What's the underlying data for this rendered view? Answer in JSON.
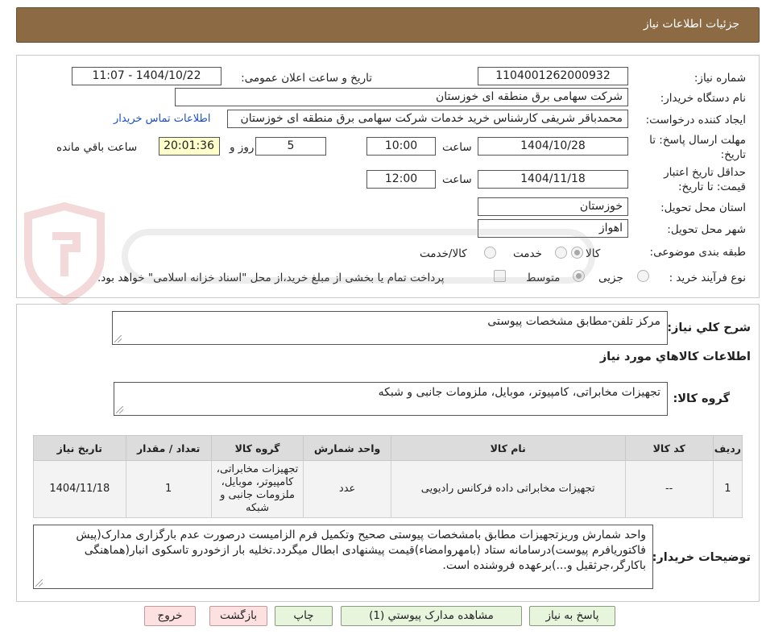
{
  "header": {
    "title": "جزئیات اطلاعات نیاز"
  },
  "form": {
    "need_number_label": "شماره نیاز:",
    "need_number": "1104001262000932",
    "announce_label": "تاریخ و ساعت اعلان عمومی:",
    "announce_value": "1404/10/22 - 11:07",
    "buyer_org_label": "نام دستگاه خریدار:",
    "buyer_org": "شرکت سهامی برق منطقه ای خوزستان",
    "creator_label": "ایجاد کننده درخواست:",
    "creator": "محمدباقر شریفی کارشناس خرید خدمات شرکت سهامی برق منطقه ای خوزستان",
    "contact_link": "اطلاعات تماس خریدار",
    "deadline_label": "مهلت ارسال پاسخ: تا تاریخ:",
    "deadline_date": "1404/10/28",
    "time_word": "ساعت",
    "deadline_time": "10:00",
    "days": "5",
    "days_word": "روز و",
    "remaining_time": "20:01:36",
    "remaining_word": "ساعت باقي مانده",
    "validity_label": "حداقل تاریخ اعتبار قیمت: تا تاریخ:",
    "validity_date": "1404/11/18",
    "validity_time": "12:00",
    "province_label": "استان محل تحویل:",
    "province": "خوزستان",
    "city_label": "شهر محل تحویل:",
    "city": "اهواز",
    "category_label": "طبقه بندی موضوعی:",
    "cat_goods": "کالا",
    "cat_service": "خدمت",
    "cat_goods_service": "کالا/خدمت",
    "process_label": "نوع فرآیند خرید :",
    "proc_partial": "جزیی",
    "proc_medium": "متوسط",
    "payment_note": "پرداخت تمام یا بخشی از مبلغ خرید،از محل \"اسناد خزانه اسلامی\" خواهد بود."
  },
  "detail": {
    "summary_label": "شرح کلي نياز:",
    "summary": "مرکز تلفن-مطابق مشخصات پیوستی",
    "goods_info_title": "اطلاعات کالاهاي مورد نياز",
    "goods_group_label": "گروه کالا:",
    "goods_group": "تجهیزات مخابراتی، کامپیوتر، موبایل، ملزومات جانبی و شبکه",
    "table": {
      "headers": [
        "رديف",
        "کد کالا",
        "نام کالا",
        "واحد شمارش",
        "گروه کالا",
        "تعداد / مقدار",
        "تاريخ نياز"
      ],
      "rows": [
        [
          "1",
          "--",
          "تجهیزات مخابراتی داده فرکانس رادیویی",
          "عدد",
          "تجهیزات مخابراتی، کامپیوتر، موبایل، ملزومات جانبی و شبکه",
          "1",
          "1404/11/18"
        ]
      ]
    },
    "buyer_notes_label": "توضيحات خريدار:",
    "buyer_notes": "واحد شمارش وریزتجهیزات مطابق بامشخصات پیوستی صحیح وتکمیل فرم الزامیست درصورت عدم بارگزاری مدارک(پیش فاکتوریافرم پیوست)درسامانه ستاد (بامهروامضاء)قیمت پیشنهادی ابطال میگردد.تخلیه بار ازخودرو تاسکوی انبار(هماهنگی باکارگر،جرثقیل و...)برعهده فروشنده است."
  },
  "buttons": {
    "reply": "پاسخ به نياز",
    "view_docs": "مشاهده مدارک پيوستي (1)",
    "print": "چاپ",
    "back": "بازگشت",
    "exit": "خروج"
  },
  "colors": {
    "header_bg": "#8b6a44",
    "button_green": "#e6f5dc",
    "button_pink": "#fde0e0",
    "link": "#1a4fc4"
  }
}
